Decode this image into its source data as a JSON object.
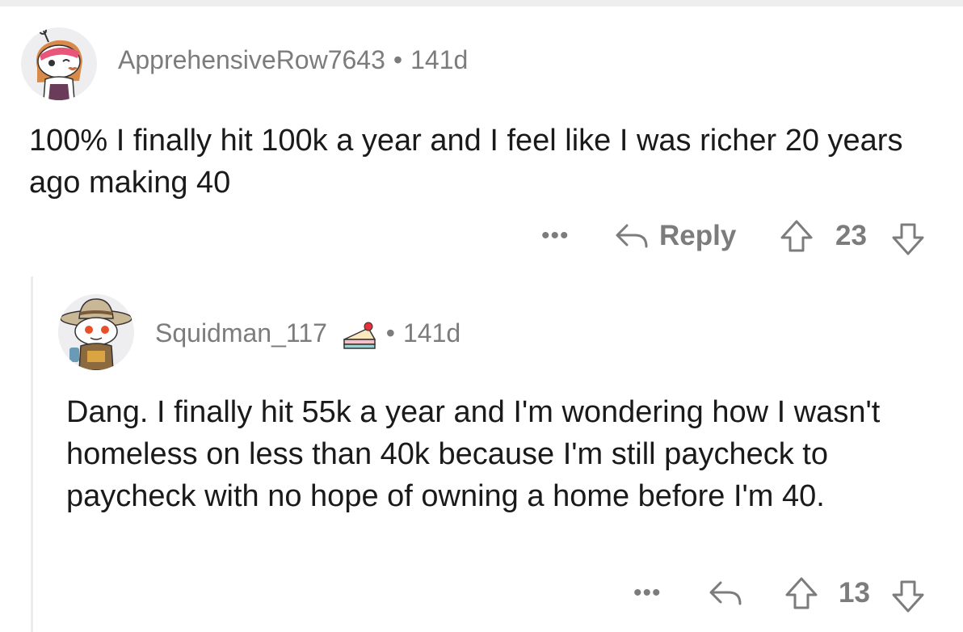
{
  "comments": [
    {
      "username": "ApprehensiveRow7643",
      "separator": "•",
      "age": "141d",
      "body": "100% I finally hit 100k a year and I feel like I was richer 20 years ago making 40",
      "actions": {
        "more": "•••",
        "reply_label": "Reply",
        "score": "23"
      },
      "icons": {
        "more": "more-options-icon",
        "reply": "reply-arrow-icon",
        "upvote": "upvote-arrow-icon",
        "downvote": "downvote-arrow-icon"
      }
    },
    {
      "username": "Squidman_117",
      "separator": "•",
      "age": "141d",
      "flair": "cake-day-icon",
      "body": "Dang. I finally hit 55k a year and I'm wondering how I wasn't homeless on less than 40k because I'm still paycheck to paycheck with no hope of owning a home before I'm 40.",
      "actions": {
        "more": "•••",
        "score": "13"
      },
      "icons": {
        "more": "more-options-icon",
        "reply": "reply-arrow-icon",
        "upvote": "upvote-arrow-icon",
        "downvote": "downvote-arrow-icon"
      }
    }
  ],
  "colors": {
    "text": "#1a1a1b",
    "meta": "#7c7c7c",
    "thread_line": "#ececec",
    "avatar_bg": "#eeeef0"
  }
}
